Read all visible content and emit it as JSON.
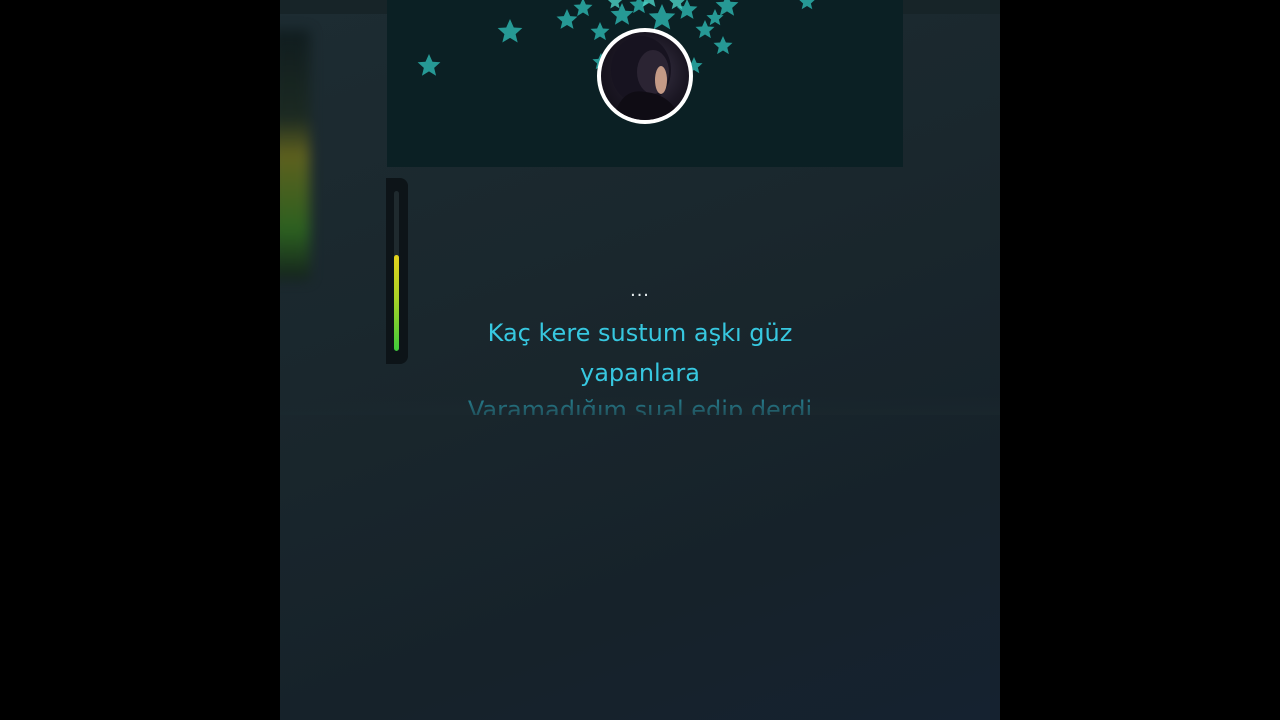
{
  "player": {
    "avatar_icon": "profile-photo",
    "banner_decoration": "star-icon",
    "accent_color": "#37c8e0",
    "dots": "...",
    "meter_level": 0.6,
    "lyrics": {
      "current_line_1": "Kaç kere sustum aşkı güz",
      "current_line_2": "yapanlara",
      "next_line": "Varamadığım sual edip derdi"
    }
  }
}
